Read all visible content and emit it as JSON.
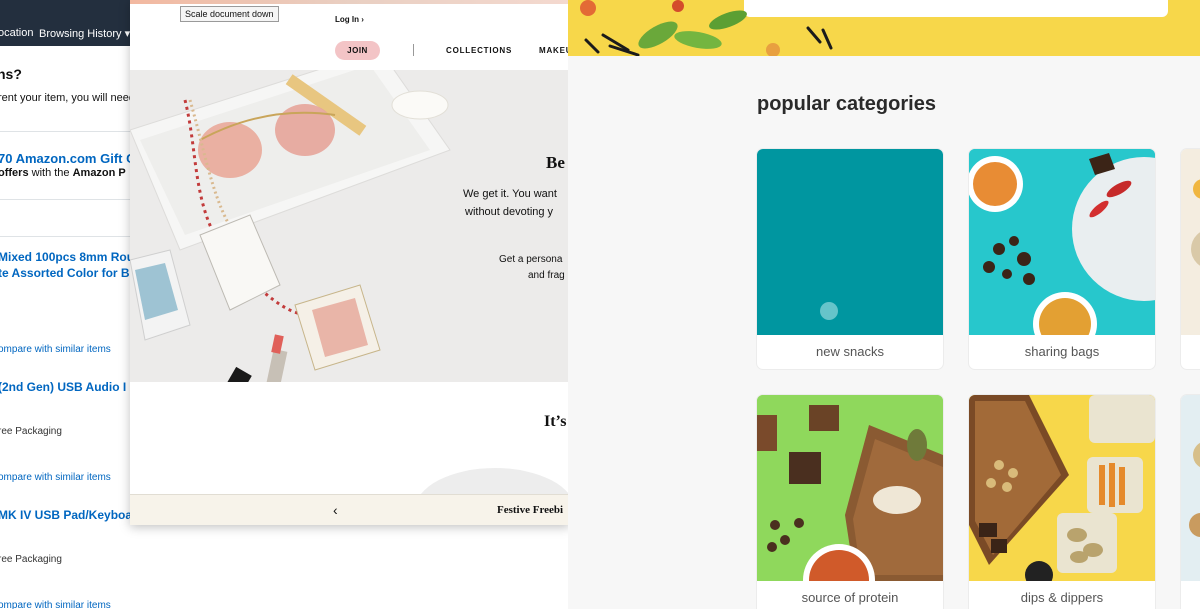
{
  "amazon": {
    "nav": {
      "location": "ocation",
      "history": "Browsing History ▾"
    },
    "question": "ns?",
    "question_sub": "rent your item, you will need",
    "gift_title": "70 Amazon.com Gift C",
    "gift_offers_pre": "offers",
    "gift_offers_mid": " with the ",
    "gift_offers_bold": "Amazon P",
    "items": [
      {
        "title_1": "Mixed 100pcs 8mm Rou",
        "title_2": "te Assorted Color for B",
        "compare": "ompare with similar items"
      },
      {
        "title_1": " (2nd Gen) USB Audio I",
        "packaging": "ree Packaging",
        "compare": "ompare with similar items"
      },
      {
        "title_1": "MK IV USB Pad/Keyboa",
        "packaging": "ree Packaging",
        "compare": "ompare with similar items"
      }
    ]
  },
  "beauty_window": {
    "tooltip": "Scale document down",
    "login": "Log In ›",
    "join": "JOIN",
    "nav": {
      "collections": "COLLECTIONS",
      "makeup": "MAKEU"
    },
    "hero": {
      "heading": "Be",
      "line_1": "We get it. You want",
      "line_2": "without devoting y",
      "line_3": "Get a persona",
      "line_4": "and frag"
    },
    "section_heading": "It’s",
    "footer": {
      "prev": "‹",
      "title": "Festive Freebi"
    }
  },
  "snacks": {
    "heading": "popular categories",
    "categories": [
      {
        "label": "new snacks",
        "bg": "#0096a0"
      },
      {
        "label": "sharing bags",
        "bg": "#27c7cc"
      },
      {
        "label": "source of protein",
        "bg": "#8fd85c"
      },
      {
        "label": "dips & dippers",
        "bg": "#f7d74a"
      }
    ]
  },
  "colors": {
    "amazon_nav": "#232f3e",
    "amazon_link": "#0066c0",
    "join_pill": "#f3c4c6",
    "banner_yellow": "#f7d74a"
  }
}
